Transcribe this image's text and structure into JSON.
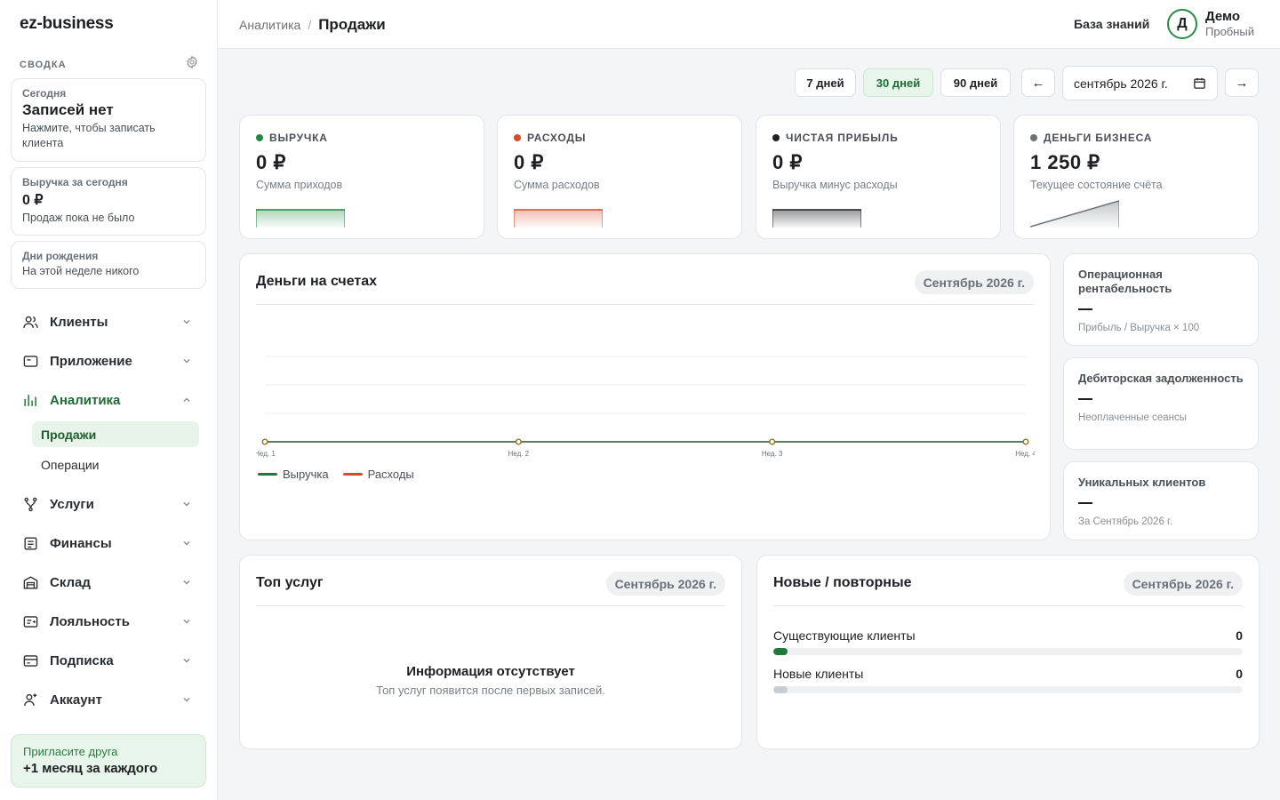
{
  "app": {
    "logo": "ez-business"
  },
  "sidebar": {
    "summary_title": "СВОДКА",
    "cards": {
      "today": {
        "label": "Сегодня",
        "title": "Записей нет",
        "sub": "Нажмите, чтобы записать клиента"
      },
      "revenue": {
        "label": "Выручка за сегодня",
        "value": "0 ₽",
        "sub": "Продаж пока не было"
      },
      "birthdays": {
        "label": "Дни рождения",
        "sub": "На этой неделе никого"
      }
    },
    "nav": {
      "clients": "Клиенты",
      "app": "Приложение",
      "analytics": "Аналитика",
      "sales": "Продажи",
      "operations": "Операции",
      "services": "Услуги",
      "finance": "Финансы",
      "warehouse": "Склад",
      "loyalty": "Лояльность",
      "subscription": "Подписка",
      "account": "Аккаунт"
    },
    "invite": {
      "line1": "Пригласите друга",
      "line2": "+1 месяц за каждого"
    }
  },
  "header": {
    "crumb_parent": "Аналитика",
    "crumb_sep": "/",
    "crumb_current": "Продажи",
    "knowledge_base": "База знаний",
    "avatar_letter": "Д",
    "user_name": "Демо",
    "user_plan": "Пробный"
  },
  "controls": {
    "d7": "7 дней",
    "d30": "30 дней",
    "d90": "90 дней",
    "prev": "←",
    "next": "→",
    "month": "сентябрь 2026 г.",
    "selected_range": "30 дней"
  },
  "kpis": {
    "revenue": {
      "label": "ВЫРУЧКА",
      "value": "0 ₽",
      "sub": "Сумма приходов",
      "color": "#1e8a3e"
    },
    "expenses": {
      "label": "РАСХОДЫ",
      "value": "0 ₽",
      "sub": "Сумма расходов",
      "color": "#d84a2a"
    },
    "profit": {
      "label": "ЧИСТАЯ ПРИБЫЛЬ",
      "value": "0 ₽",
      "sub": "Выручка минус расходы",
      "color": "#1d1f23"
    },
    "money": {
      "label": "ДЕНЬГИ БИЗНЕСА",
      "value": "1 250 ₽",
      "sub": "Текущее состояние счёта",
      "color": "#6b7177"
    }
  },
  "accounts_panel": {
    "title": "Деньги на счетах",
    "period": "Сентябрь 2026 г."
  },
  "chart_data": {
    "type": "line",
    "categories": [
      "Нед. 1",
      "Нед. 2",
      "Нед. 3",
      "Нед. 4"
    ],
    "series": [
      {
        "name": "Выручка",
        "values": [
          0,
          0,
          0,
          0
        ],
        "color": "#1e7a3a"
      },
      {
        "name": "Расходы",
        "values": [
          0,
          0,
          0,
          0
        ],
        "color": "#d84a2a"
      }
    ],
    "grid": true,
    "legend": "bottom-left"
  },
  "metrics": {
    "margin": {
      "title": "Операционная рентабельность",
      "value": "—",
      "sub": "Прибыль / Выручка × 100"
    },
    "receivables": {
      "title": "Дебиторская задолженность",
      "value": "—",
      "sub": "Неоплаченные сеансы"
    },
    "unique": {
      "title": "Уникальных клиентов",
      "value": "—",
      "sub": "За Сентябрь 2026 г."
    }
  },
  "top_services": {
    "title": "Топ услуг",
    "period": "Сентябрь 2026 г.",
    "empty_title": "Информация отсутствует",
    "empty_sub": "Топ услуг появится после первых записей."
  },
  "new_returning": {
    "title": "Новые / повторные",
    "period": "Сентябрь 2026 г.",
    "rows": [
      {
        "label": "Существующие клиенты",
        "value": "0",
        "color": "#1e7a3a"
      },
      {
        "label": "Новые клиенты",
        "value": "0",
        "color": "#c9ccd0"
      }
    ]
  }
}
